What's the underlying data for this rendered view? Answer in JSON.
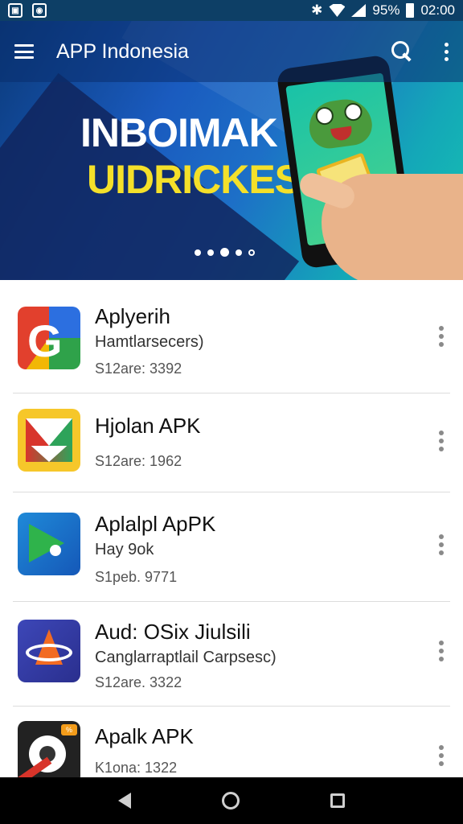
{
  "status_bar": {
    "icons_left": [
      "image-notification-icon",
      "app-notification-icon"
    ],
    "battery_text": "95%",
    "time": "02:00"
  },
  "app_bar": {
    "title": "APP Indonesia"
  },
  "hero": {
    "headline_line1": "INBOIMAK",
    "headline_line2": "UIDRICKESAI",
    "carousel_dots": 5,
    "carousel_active_index": 2,
    "colors": {
      "headline1": "#ffffff",
      "headline2": "#f4e02a"
    }
  },
  "apps": [
    {
      "name": "Aplyerih",
      "subtitle": "Hamtlarsecers)",
      "meta": "S12are: 3392",
      "icon": "google-g-icon"
    },
    {
      "name": "Hjolan APK",
      "subtitle": "",
      "meta": "S12are: 1962",
      "icon": "envelope-icon"
    },
    {
      "name": "Aplalpl ApPK",
      "subtitle": "Hay 9ok",
      "meta": "S1peb. 9771",
      "icon": "play-store-icon"
    },
    {
      "name": "Aud: OSix Jiulsili",
      "subtitle": "Canglarraptlail Carpsesc)",
      "meta": "S12are. 3322",
      "icon": "orbit-arrow-icon"
    },
    {
      "name": "Apalk APK",
      "subtitle": "",
      "meta": "K1ona: 1322",
      "icon": "disc-icon"
    }
  ],
  "nav_bar": {
    "icons": [
      "back-icon",
      "home-icon",
      "recents-icon"
    ]
  }
}
